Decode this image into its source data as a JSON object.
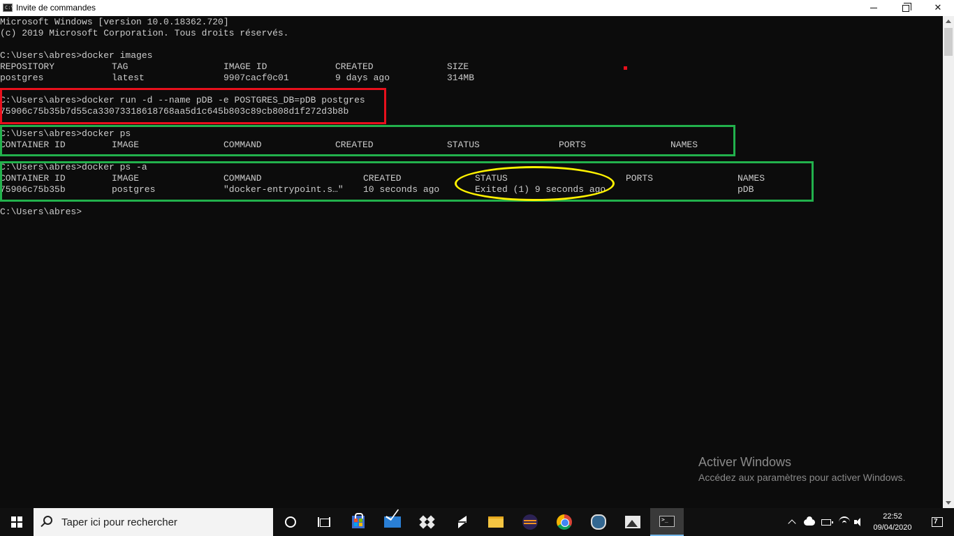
{
  "window": {
    "title": "Invite de commandes",
    "icon": "cmd-icon"
  },
  "console": {
    "lines": [
      {
        "text": "Microsoft Windows [version 10.0.18362.720]"
      },
      {
        "text": "(c) 2019 Microsoft Corporation. Tous droits réservés."
      },
      {
        "text": ""
      },
      {
        "text": "C:\\Users\\abres>docker images"
      },
      {
        "cols": [
          "REPOSITORY",
          "TAG",
          "IMAGE ID",
          "CREATED",
          "SIZE"
        ]
      },
      {
        "cols": [
          "postgres",
          "latest",
          "9907cacf0c01",
          "9 days ago",
          "314MB"
        ]
      },
      {
        "text": ""
      },
      {
        "text": "C:\\Users\\abres>docker run -d --name pDB -e POSTGRES_DB=pDB postgres"
      },
      {
        "text": "75906c75b35b7d55ca33073318618768aa5d1c645b803c89cb808d1f272d3b8b"
      },
      {
        "text": ""
      },
      {
        "text": "C:\\Users\\abres>docker ps"
      },
      {
        "cols": [
          "CONTAINER ID",
          "IMAGE",
          "COMMAND",
          "CREATED",
          "STATUS",
          "PORTS",
          "NAMES"
        ]
      },
      {
        "text": ""
      },
      {
        "text": "C:\\Users\\abres>docker ps -a"
      },
      {
        "cols": [
          "CONTAINER ID",
          "IMAGE",
          "COMMAND",
          "CREATED",
          "STATUS",
          "PORTS",
          "NAMES"
        ]
      },
      {
        "cols": [
          "75906c75b35b",
          "postgres",
          "\"docker-entrypoint.s…\"",
          "10 seconds ago",
          "Exited (1) 9 seconds ago",
          "",
          "pDB"
        ]
      },
      {
        "text": ""
      },
      {
        "text": "C:\\Users\\abres>"
      }
    ]
  },
  "watermark": {
    "title": "Activer Windows",
    "subtitle": "Accédez aux paramètres pour activer Windows."
  },
  "taskbar": {
    "search_placeholder": "Taper ici pour rechercher",
    "apps": [
      "cortana-icon",
      "task-view-icon",
      "store-icon",
      "mail-icon",
      "dropbox-icon",
      "sublime-text-icon",
      "file-explorer-icon",
      "eclipse-icon",
      "chrome-icon",
      "pgadmin-icon",
      "photos-icon",
      "cmd-icon"
    ],
    "clock_time": "22:52",
    "clock_date": "09/04/2020",
    "notification_count": "7"
  },
  "colors": {
    "console_bg": "#0c0c0c",
    "console_fg": "#cccccc",
    "highlight_red": "#e8101c",
    "highlight_green": "#22b14c",
    "highlight_yellow": "#fff200"
  }
}
